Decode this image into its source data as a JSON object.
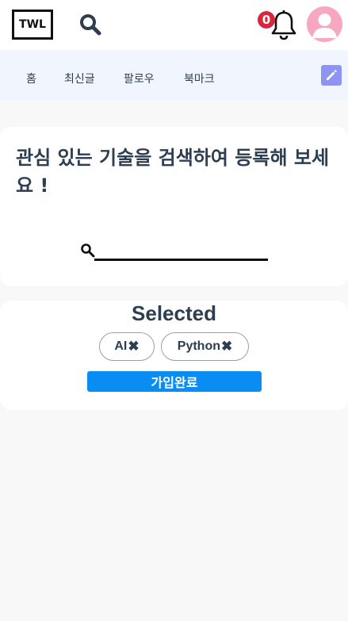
{
  "header": {
    "logo_text": "TWL",
    "notification_count": "0",
    "icons": [
      "search-icon",
      "bell-icon",
      "avatar-icon"
    ],
    "avatar_color": "#f7a8c0",
    "badge_color": "#d7263d"
  },
  "nav": {
    "items": [
      {
        "label": "홈"
      },
      {
        "label": "최신글"
      },
      {
        "label": "팔로우"
      },
      {
        "label": "북마크"
      }
    ],
    "edit_icon": "pencil-icon",
    "edit_color": "#8e94f2"
  },
  "search_card": {
    "headline": "관심 있는 기술을 검색하여 등록해 보세요 !",
    "input_value": "",
    "input_placeholder": ""
  },
  "selected_card": {
    "title": "Selected",
    "chips": [
      {
        "label": "AI",
        "remove": "✖"
      },
      {
        "label": "Python",
        "remove": "✖"
      }
    ],
    "join_label": "가입완료",
    "join_color": "#0a8df2"
  }
}
